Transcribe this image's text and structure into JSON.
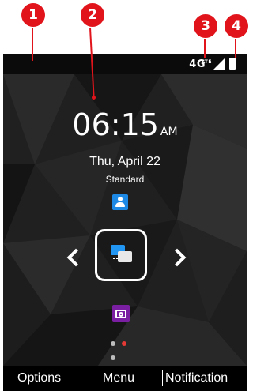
{
  "callouts": [
    "1",
    "2",
    "3",
    "4"
  ],
  "status_bar": {
    "network": "4G",
    "network_sub": "LTE"
  },
  "clock": {
    "time": "06:15",
    "ampm": "AM"
  },
  "date": "Thu, April 22",
  "profile": "Standard",
  "apps": {
    "top": "contacts-icon",
    "center": "messages-icon",
    "bottom": "camera-icon"
  },
  "page_indicator": {
    "count": 3,
    "active": 2
  },
  "softkeys": {
    "left": "Options",
    "center": "Menu",
    "right": "Notification"
  },
  "colors": {
    "callout": "#e1141c",
    "contacts": "#1e88e5",
    "messages": "#2196f3",
    "camera": "#7b1fa2",
    "page_active": "#e53935"
  }
}
